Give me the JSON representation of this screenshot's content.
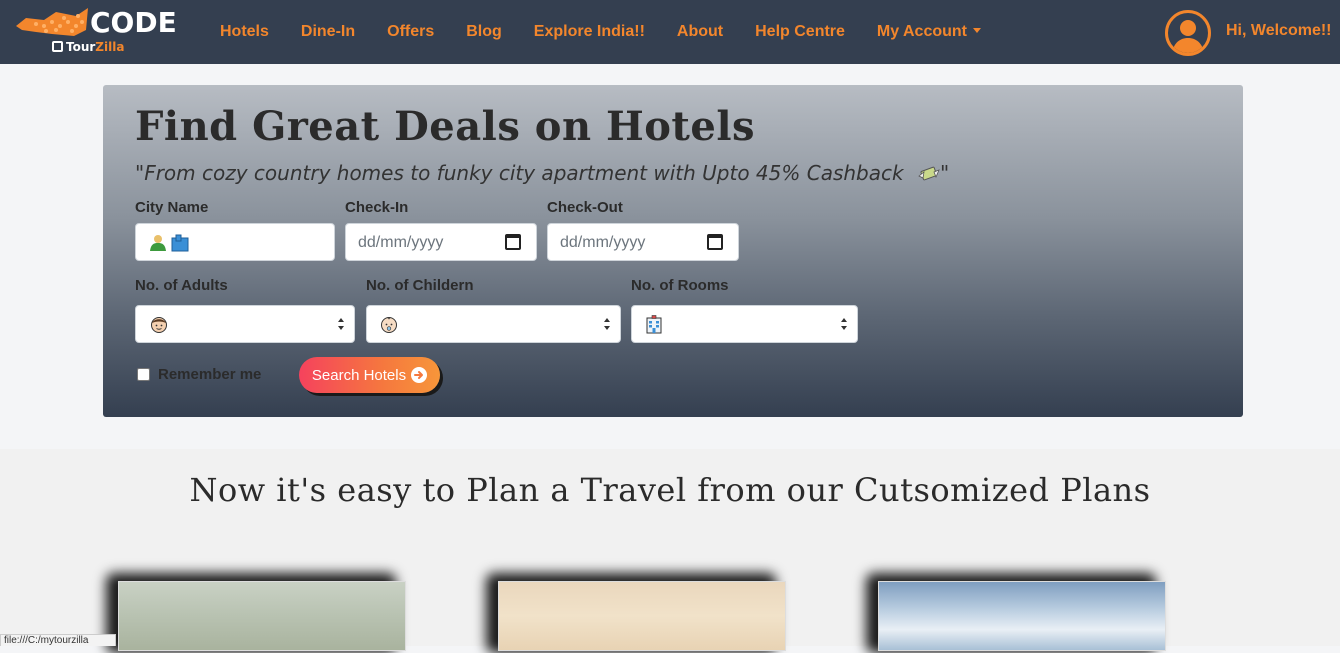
{
  "brand": {
    "name": "CODE",
    "sub_prefix": "Tour",
    "sub_suffix": "Zilla"
  },
  "nav": {
    "links": [
      "Hotels",
      "Dine-In",
      "Offers",
      "Blog",
      "Explore India!!",
      "About",
      "Help Centre"
    ],
    "account_label": "My Account",
    "welcome": "Hi, Welcome!!"
  },
  "hero": {
    "title": "Find Great Deals on Hotels",
    "quote": "\"From cozy country homes to funky city apartment with Upto 45% Cashback",
    "quote_end": "\"",
    "city_label": "City Name",
    "city_value": "",
    "checkin_label": "Check-In",
    "checkin_placeholder": "dd/mm/yyyy",
    "checkout_label": "Check-Out",
    "checkout_placeholder": "dd/mm/yyyy",
    "adults_label": "No. of Adults",
    "children_label": "No. of Childern",
    "rooms_label": "No. of Rooms",
    "remember_label": "Remember me",
    "remember_checked": false,
    "search_button": "Search Hotels"
  },
  "plans": {
    "title": "Now it's easy to Plan a Travel from our Cutsomized Plans"
  },
  "status_bar": "file:///C:/mytourzilla",
  "colors": {
    "navbar": "#343f50",
    "accent": "#f3862c",
    "button_start": "#f5425d",
    "button_end": "#f7963a"
  },
  "icons": [
    "user-avatar-icon",
    "money-wings-icon",
    "calendar-icon",
    "person-icon",
    "cityscape-icon",
    "face-icon",
    "baby-icon",
    "hotel-icon",
    "arrow-right-circle-icon"
  ]
}
